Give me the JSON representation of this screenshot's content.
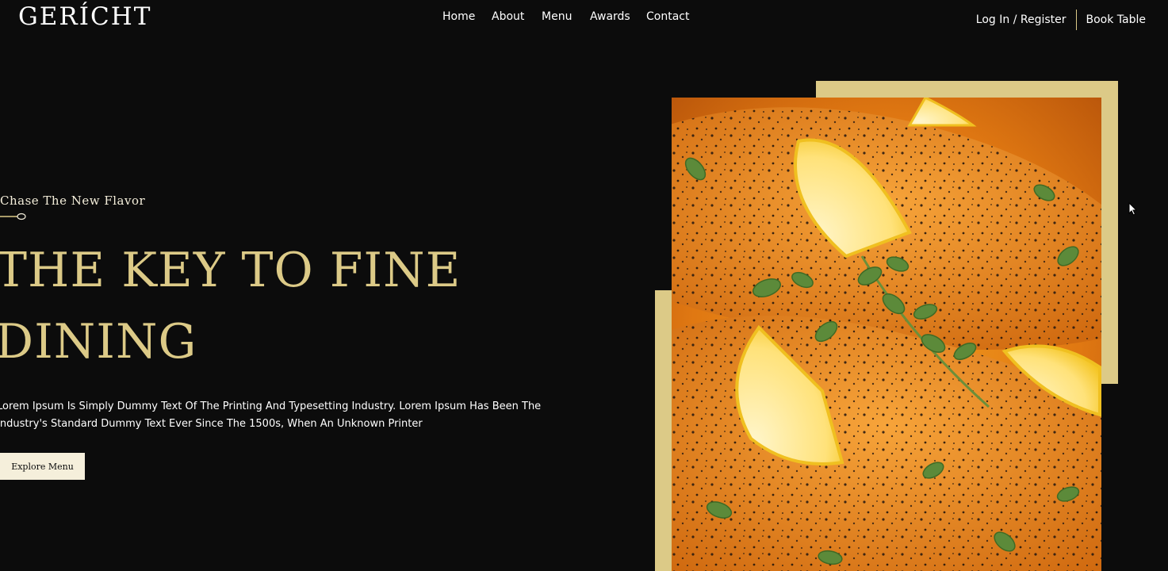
{
  "brand": {
    "logo_text": "GERÍCHT"
  },
  "nav": {
    "home": "Home",
    "about": "About",
    "menu": "Menu",
    "awards": "Awards",
    "contact": "Contact",
    "login": "Log In / Register",
    "book": "Book Table"
  },
  "hero": {
    "subtitle": "Chase The New Flavor",
    "headline": "THE KEY TO FINE DINING",
    "paragraph": "Lorem Ipsum Is Simply Dummy Text Of The Printing And Typesetting Industry. Lorem Ipsum Has Been The Industry's Standard Dummy Text Ever Since The 1500s, When An Unknown Printer",
    "cta_label": "Explore Menu",
    "image_alt": "Grilled salmon with lemon slices and fresh oregano"
  },
  "colors": {
    "background": "#0c0c0c",
    "gold": "#dcca87",
    "cream": "#f5efdb",
    "white": "#ffffff"
  },
  "icons": {
    "spoon": "spoon-icon",
    "cursor": "mouse-cursor-icon"
  }
}
